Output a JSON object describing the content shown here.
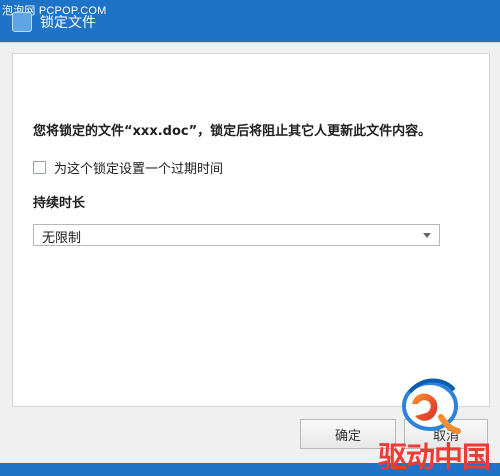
{
  "window": {
    "title": "锁定文件",
    "watermark": "泡泡网 PCPOP.COM"
  },
  "content": {
    "message": "您将锁定的文件“xxx.doc”，锁定后将阻止其它人更新此文件内容。",
    "expire_checkbox_label": "为这个锁定设置一个过期时间",
    "expire_checked": false,
    "duration_label": "持续时长",
    "duration_value": "无限制"
  },
  "buttons": {
    "ok": "确定",
    "cancel": "取消"
  },
  "brand": {
    "text": "驱动中国",
    "accent": "#ef3b35",
    "blue": "#1f73c6"
  }
}
